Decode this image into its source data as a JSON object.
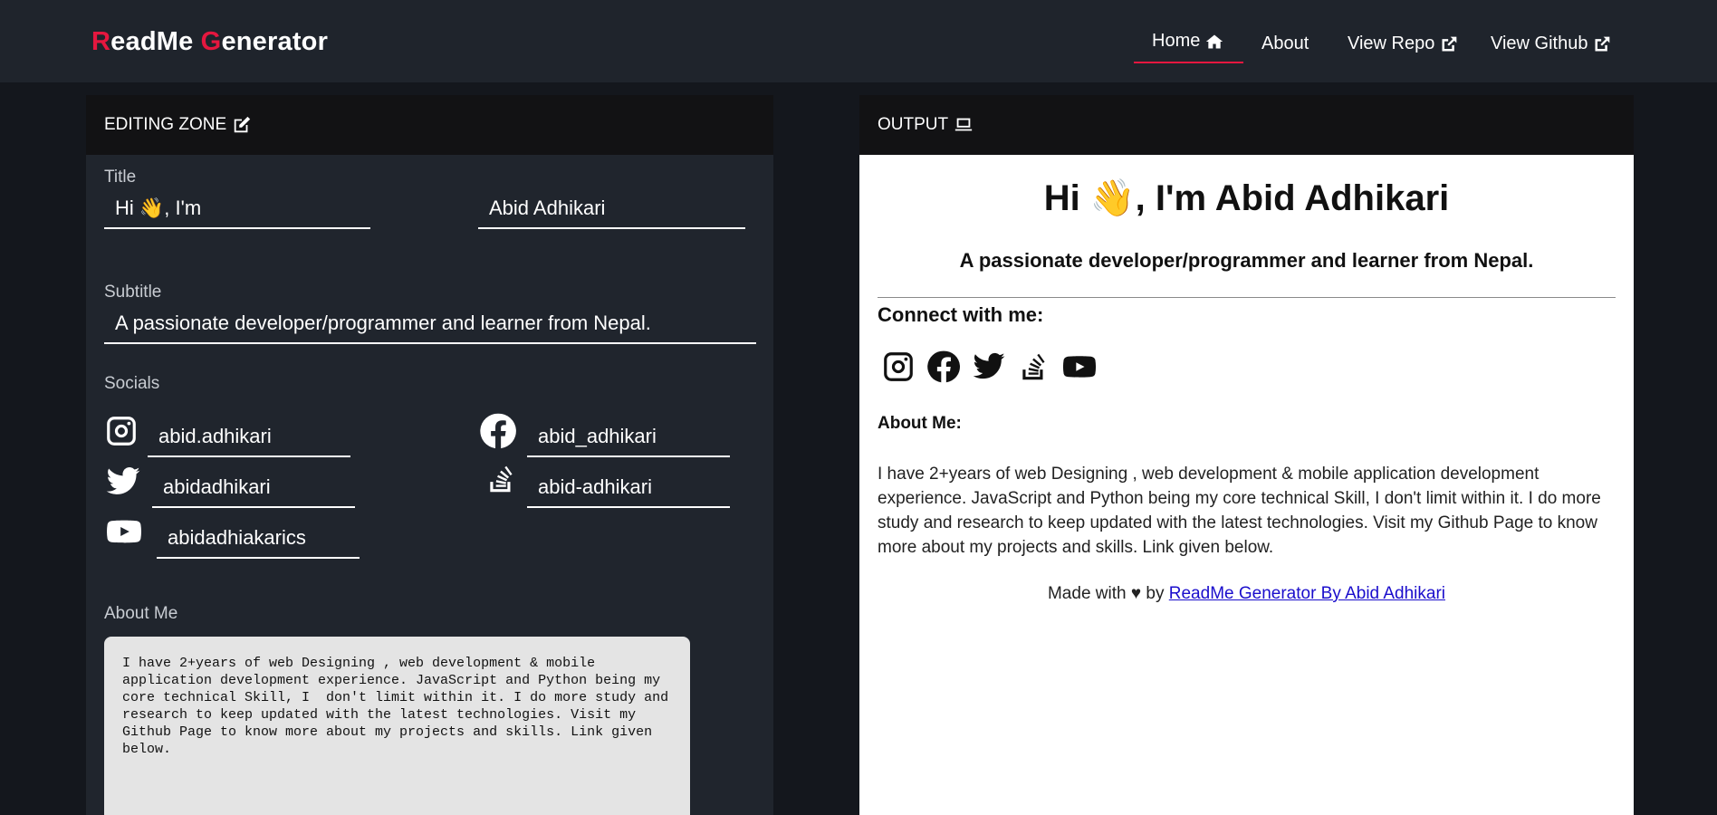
{
  "nav": {
    "brand_r": "R",
    "brand_rest1": "eadMe ",
    "brand_g": "G",
    "brand_rest2": "enerator",
    "home": "Home",
    "about": "About",
    "view_repo": "View Repo",
    "view_github": "View Github"
  },
  "editor": {
    "heading": "EDITING ZONE",
    "title_label": "Title",
    "title_prefix": "Hi 👋, I'm",
    "title_name": "Abid Adhikari",
    "subtitle_label": "Subtitle",
    "subtitle_value": "A passionate developer/programmer and learner from Nepal.",
    "socials_label": "Socials",
    "instagram": "abid.adhikari",
    "facebook": "abid_adhikari",
    "twitter": "abidadhikari",
    "stackoverflow": "abid-adhikari",
    "youtube": "abidadhiakarics",
    "about_label": "About Me",
    "about_value": "I have 2+years of web Designing , web development & mobile application development experience. JavaScript and Python being my core technical Skill, I  don't limit within it. I do more study and research to keep updated with the latest technologies. Visit my Github Page to know more about my projects and skills. Link given below."
  },
  "output": {
    "heading": "OUTPUT",
    "title": "Hi 👋, I'm Abid Adhikari",
    "subtitle": "A passionate developer/programmer and learner from Nepal.",
    "connect": "Connect with me:",
    "about_heading": "About Me:",
    "about_text": "I have 2+years of web Designing , web development & mobile application development experience. JavaScript and Python being my core technical Skill, I don't limit within it. I do more study and research to keep updated with the latest technologies. Visit my Github Page to know more about my projects and skills. Link given below.",
    "footer_text": "Made with ♥ by ",
    "footer_link": "ReadMe Generator By Abid Adhikari"
  },
  "colors": {
    "accent": "#e5173f",
    "nav_bg": "#1f242c",
    "panel_bg": "#20252d",
    "page_bg": "#14171d"
  },
  "icons": [
    "home-icon",
    "external-link-icon",
    "edit-icon",
    "laptop-icon",
    "instagram-icon",
    "facebook-icon",
    "twitter-icon",
    "stackoverflow-icon",
    "youtube-icon"
  ]
}
